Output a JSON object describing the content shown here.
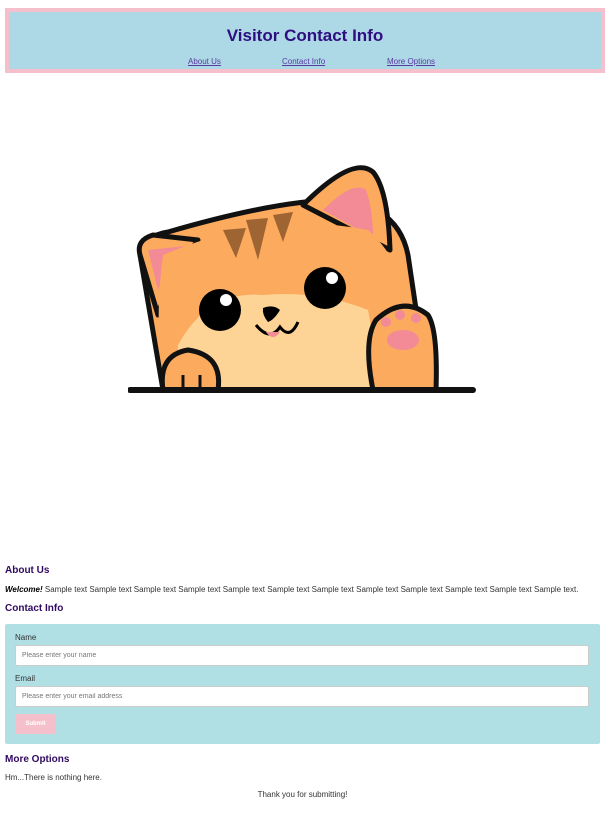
{
  "header": {
    "title": "Visitor Contact Info",
    "nav": [
      "About Us",
      "Contact Info",
      "More Options"
    ]
  },
  "hero": {
    "image": "waving-cartoon-cat"
  },
  "about": {
    "heading": "About Us",
    "welcome": "Welcome!",
    "text": "Sample text Sample text Sample text Sample text Sample text Sample text Sample text Sample text Sample text Sample text Sample text Sample text."
  },
  "contact": {
    "heading": "Contact Info",
    "name_label": "Name",
    "name_placeholder": "Please enter your name",
    "email_label": "Email",
    "email_placeholder": "Please enter your email address",
    "submit_label": "Submit"
  },
  "more": {
    "heading": "More Options",
    "text": "Hm...There is nothing here."
  },
  "thanks": "Thank you for submitting!",
  "colors": {
    "header_bg": "#add8e6",
    "header_border": "#f5c0cb",
    "title": "#2e0e80",
    "form_bg": "#b0dfe4",
    "button": "#f5c0cb"
  }
}
